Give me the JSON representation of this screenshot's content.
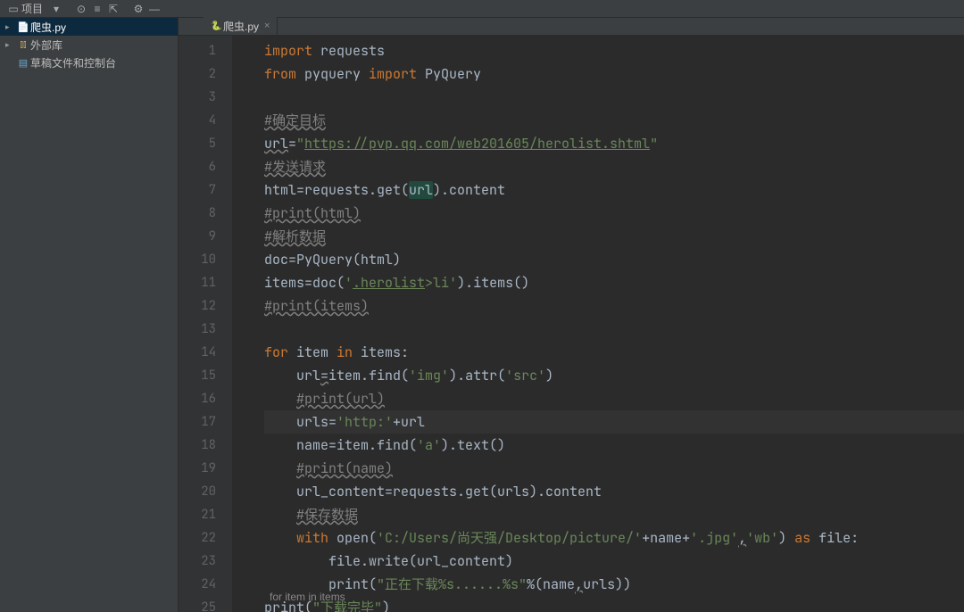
{
  "toolbar": {
    "project_label": "项目"
  },
  "tab": {
    "filename": "爬虫.py"
  },
  "tree": {
    "item1": "爬虫.py",
    "item2": "外部库",
    "item3": "草稿文件和控制台"
  },
  "gutter": {
    "lines": [
      "1",
      "2",
      "3",
      "4",
      "5",
      "6",
      "7",
      "8",
      "9",
      "10",
      "11",
      "12",
      "13",
      "14",
      "15",
      "16",
      "17",
      "18",
      "19",
      "20",
      "21",
      "22",
      "23",
      "24",
      "25"
    ]
  },
  "code": {
    "kw_import": "import",
    "kw_from": "from",
    "kw_for": "for",
    "kw_in": "in",
    "kw_with": "with",
    "kw_as": "as",
    "requests": " requests",
    "pyquery": " pyquery ",
    "pyquery_cls": " PyQuery",
    "c_target": "#确定目标",
    "l5a": "url",
    "l5eq": "=",
    "l5q": "\"",
    "l5url": "https://pvp.qq.com/web201605/herolist.shtml",
    "c_send": "#发送请求",
    "l7": "html=requests.get(",
    "l7url": "url",
    "l7b": ").content",
    "c_printhtml": "#print(html)",
    "c_parse": "#解析数据",
    "l10": "doc=PyQuery(html)",
    "l11a": "items=doc(",
    "l11s1": "'",
    "l11sel": ".herolist",
    "l11sel2": ">li",
    "l11s2": "'",
    "l11b": ").items()",
    "c_printitems": "#print(items)",
    "l14a": " item ",
    "l14b": " items:",
    "l15a": "    url",
    "l15eq": "=",
    "l15b": "item.find(",
    "l15s": "'img'",
    "l15c": ").attr(",
    "l15s2": "'src'",
    "l15d": ")",
    "c_printurl": "#print(url)",
    "l17a": "    urls=",
    "l17s": "'http:'",
    "l17b": "+url",
    "l18a": "    name=item.find(",
    "l18s": "'a'",
    "l18b": ").text()",
    "c_printname": "#print(name)",
    "l20": "    url_content=requests.get(urls).content",
    "c_save": "#保存数据",
    "l22a": "    ",
    "l22b": " open(",
    "l22s1": "'C:/Users/尚天强/Desktop/picture/'",
    "l22c": "+name+",
    "l22s2": "'.jpg'",
    "l22comma": ",",
    "l22s3": "'wb'",
    "l22d": ") ",
    "l22e": " file:",
    "l23": "        file.write(url_content)",
    "l24a": "        print(",
    "l24s": "\"正在下载%s......%s\"",
    "l24b": "%(name",
    "l24c": "urls))",
    "l25a": "print(",
    "l25s": "\"下载完毕\"",
    "l25b": ")"
  },
  "breadcrumb": "for item in items"
}
